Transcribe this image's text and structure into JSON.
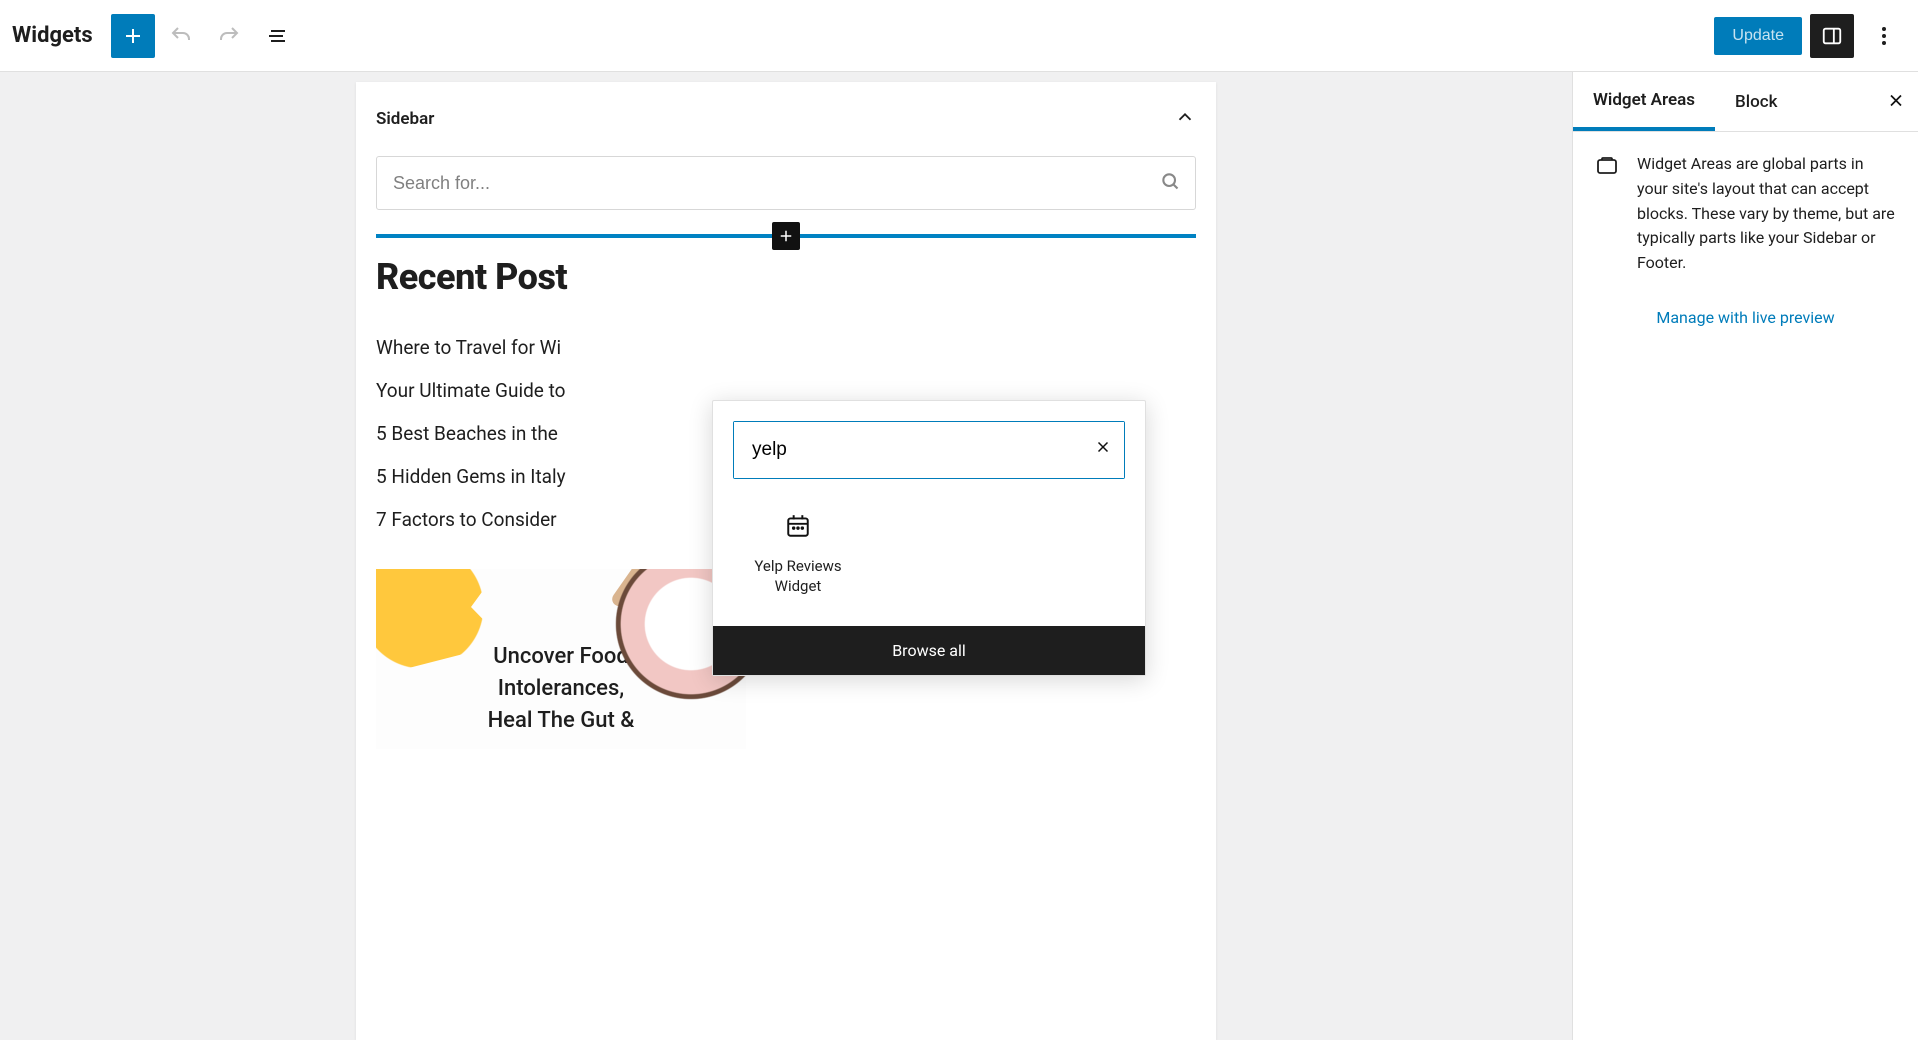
{
  "header": {
    "title": "Widgets",
    "update_label": "Update"
  },
  "panel": {
    "title": "Sidebar"
  },
  "search_widget": {
    "placeholder": "Search for..."
  },
  "recent": {
    "heading": "Recent Posts",
    "heading_truncated": "Recent Post",
    "items": [
      "Where to Travel for Wi",
      "Your Ultimate Guide to",
      "5 Best Beaches in the",
      "5 Hidden Gems in Italy",
      "7 Factors to Consider"
    ]
  },
  "promo": {
    "line1": "Uncover Food",
    "line2": "Intolerances,",
    "line3": "Heal The Gut &"
  },
  "inserter": {
    "search_value": "yelp",
    "result_label": "Yelp Reviews Widget",
    "browse_label": "Browse all"
  },
  "settings": {
    "tabs": {
      "widget_areas": "Widget Areas",
      "block": "Block"
    },
    "description": "Widget Areas are global parts in your site's layout that can accept blocks. These vary by theme, but are typically parts like your Sidebar or Footer.",
    "manage_link": "Manage with live preview"
  }
}
